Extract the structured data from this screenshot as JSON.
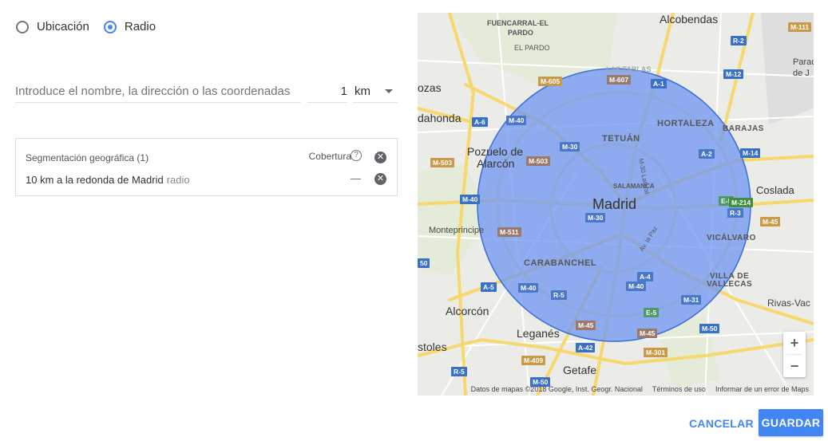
{
  "radio": {
    "options": [
      {
        "label": "Ubicación",
        "checked": false
      },
      {
        "label": "Radio",
        "checked": true
      }
    ]
  },
  "search": {
    "placeholder": "Introduce el nombre, la dirección o las coordenadas",
    "radius_value": "1",
    "unit": "km"
  },
  "targeting": {
    "title": "Segmentación geográfica (1)",
    "coverage_label": "Cobertura",
    "help_glyph": "?",
    "close_glyph": "✕",
    "row_text": "10 km a la redonda de Madrid",
    "row_type": "radio",
    "row_dash": "—"
  },
  "map": {
    "center_label": "Madrid",
    "cities": {
      "alcobendas": "Alcobendas",
      "fuencarral": "FUENCARRAL-EL",
      "pardo": "PARDO",
      "el_pardo": "EL PARDO",
      "las_tablas": "LAS TABLAS",
      "rozas": "ozas",
      "majadahonda": "dahonda",
      "pozuelo1": "Pozuelo de",
      "pozuelo2": "Alarcón",
      "tetuan": "TETUÁN",
      "hortaleza": "HORTALEZA",
      "barajas": "BARAJAS",
      "salamanca": "SALAMANCA",
      "coslada": "Coslada",
      "monteprincipe": "Monteprincipe",
      "vicalvaro": "VICÁLVARO",
      "carabanchel": "CARABANCHEL",
      "villa1": "VILLA DE",
      "villa2": "VALLECAS",
      "alcorcon": "Alcorcón",
      "rivas": "Rivas-Vac",
      "leganes": "Leganés",
      "mostoles": "stoles",
      "getafe": "Getafe",
      "paracuellos1": "Parac",
      "paracuellos2": "de J",
      "m30_lateral": "M-30 Lateral",
      "av_paz": "Av. la Paz"
    },
    "shields": {
      "m111": "M-111",
      "r2": "R-2",
      "m12": "M-12",
      "m605": "M-605",
      "m607": "M-607",
      "a1": "A-1",
      "a6": "A-6",
      "m40a": "M-40",
      "m30a": "M-30",
      "m503a": "M-503",
      "m503b": "M-503",
      "a2": "A-2",
      "m14": "M-14",
      "m40b": "M-40",
      "e5a": "E-5",
      "m214": "M-214",
      "r3": "R-3",
      "m30b": "M-30",
      "m511": "M-511",
      "m45a": "M-45",
      "m50a": "50",
      "a5": "A-5",
      "m40c": "M-40",
      "r5a": "R-5",
      "a4": "A-4",
      "m40d": "M-40",
      "m31": "M-31",
      "e5b": "E-5",
      "m45b": "M-45",
      "m45c": "M-45",
      "m50b": "M-50",
      "a42": "A-42",
      "m301": "M-301",
      "m409": "M-409",
      "r5b": "R-5",
      "m50c": "M-50"
    },
    "zoom_in": "+",
    "zoom_out": "−",
    "attribution": "Datos de mapas ©2018 Google, Inst. Geogr. Nacional",
    "terms": "Términos de uso",
    "report": "Informar de un error de Maps"
  },
  "actions": {
    "cancel": "CANCELAR",
    "save": "GUARDAR"
  },
  "colors": {
    "accent": "#4285f4",
    "radius_fill": "#6e95f0",
    "radius_stroke": "#3a6fd8"
  }
}
